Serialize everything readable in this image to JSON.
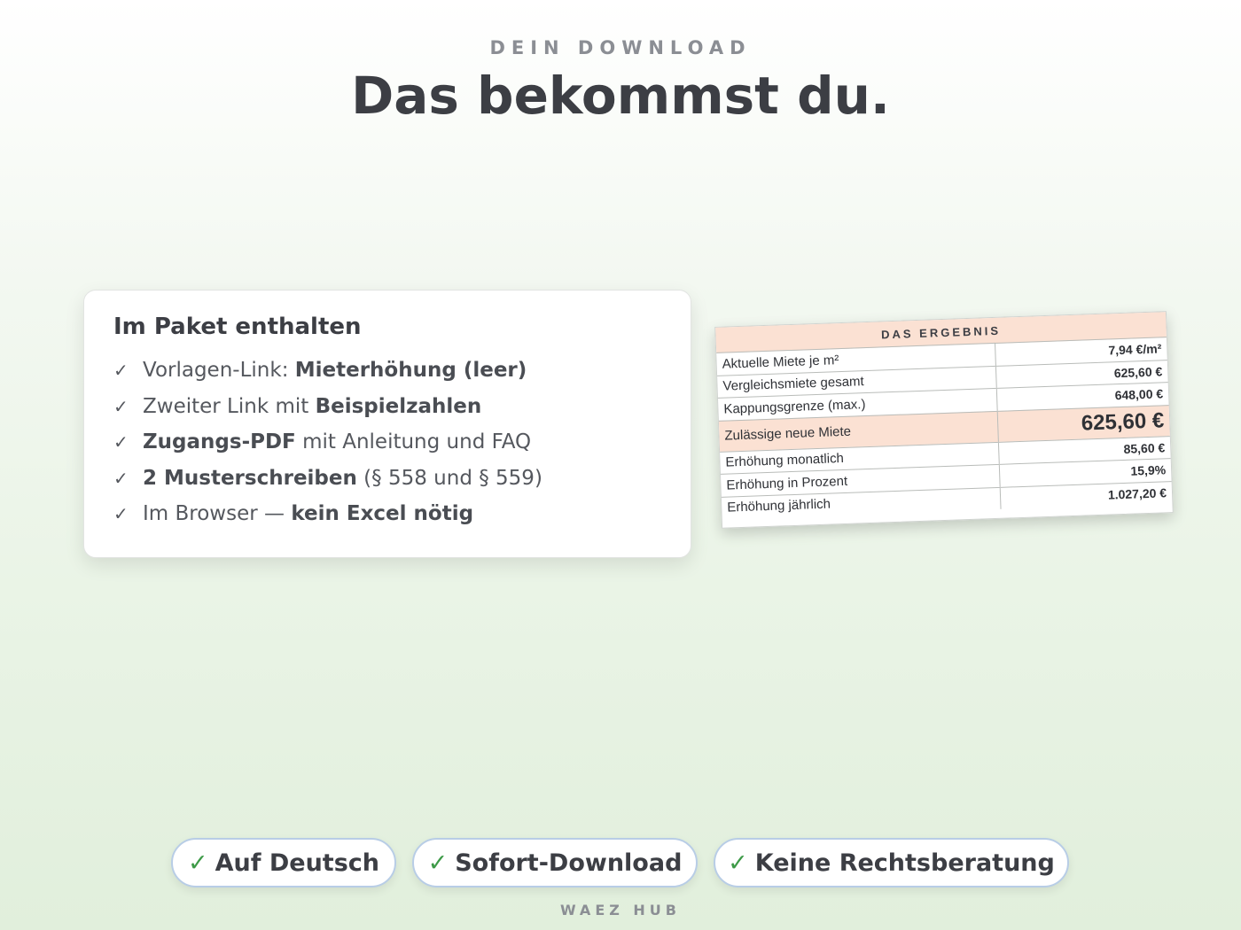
{
  "header": {
    "eyebrow": "DEIN DOWNLOAD",
    "title": "Das bekommst du."
  },
  "package": {
    "title": "Im Paket enthalten",
    "check_icon": "✓",
    "items": [
      {
        "text_before": "Vorlagen-Link: ",
        "bold": "Mieterhöhung (leer)",
        "text_after": ""
      },
      {
        "text_before": "Zweiter Link mit ",
        "bold": "Beispielzahlen",
        "text_after": ""
      },
      {
        "text_before": "",
        "bold": "Zugangs-PDF",
        "text_after": " mit Anleitung und FAQ"
      },
      {
        "text_before": "",
        "bold": "2 Musterschreiben",
        "text_after": " (§ 558 und § 559)"
      },
      {
        "text_before": "Im Browser — ",
        "bold": "kein Excel nötig",
        "text_after": ""
      }
    ]
  },
  "result": {
    "title": "DAS ERGEBNIS",
    "rows": [
      {
        "label": "Aktuelle Miete je m²",
        "value": "7,94 €/m²"
      },
      {
        "label": "Vergleichsmiete gesamt",
        "value": "625,60 €"
      },
      {
        "label": "Kappungsgrenze (max.)",
        "value": "648,00 €"
      },
      {
        "label": "Zulässige neue Miete",
        "value": "625,60 €"
      },
      {
        "label": "Erhöhung monatlich",
        "value": "85,60 €"
      },
      {
        "label": "Erhöhung in Prozent",
        "value": "15,9%"
      },
      {
        "label": "Erhöhung jährlich",
        "value": "1.027,20 €"
      }
    ]
  },
  "badges": [
    {
      "tick": "✓",
      "label": "Auf Deutsch"
    },
    {
      "tick": "✓",
      "label": "Sofort-Download"
    },
    {
      "tick": "✓",
      "label": "Keine Rechtsberatung"
    }
  ],
  "footer": "WAEZ HUB",
  "colors": {
    "accent_peach": "#fbe1d3",
    "check_green": "#3d9a47",
    "badge_border": "#b8cde6",
    "text_dark": "#3c3e44"
  }
}
